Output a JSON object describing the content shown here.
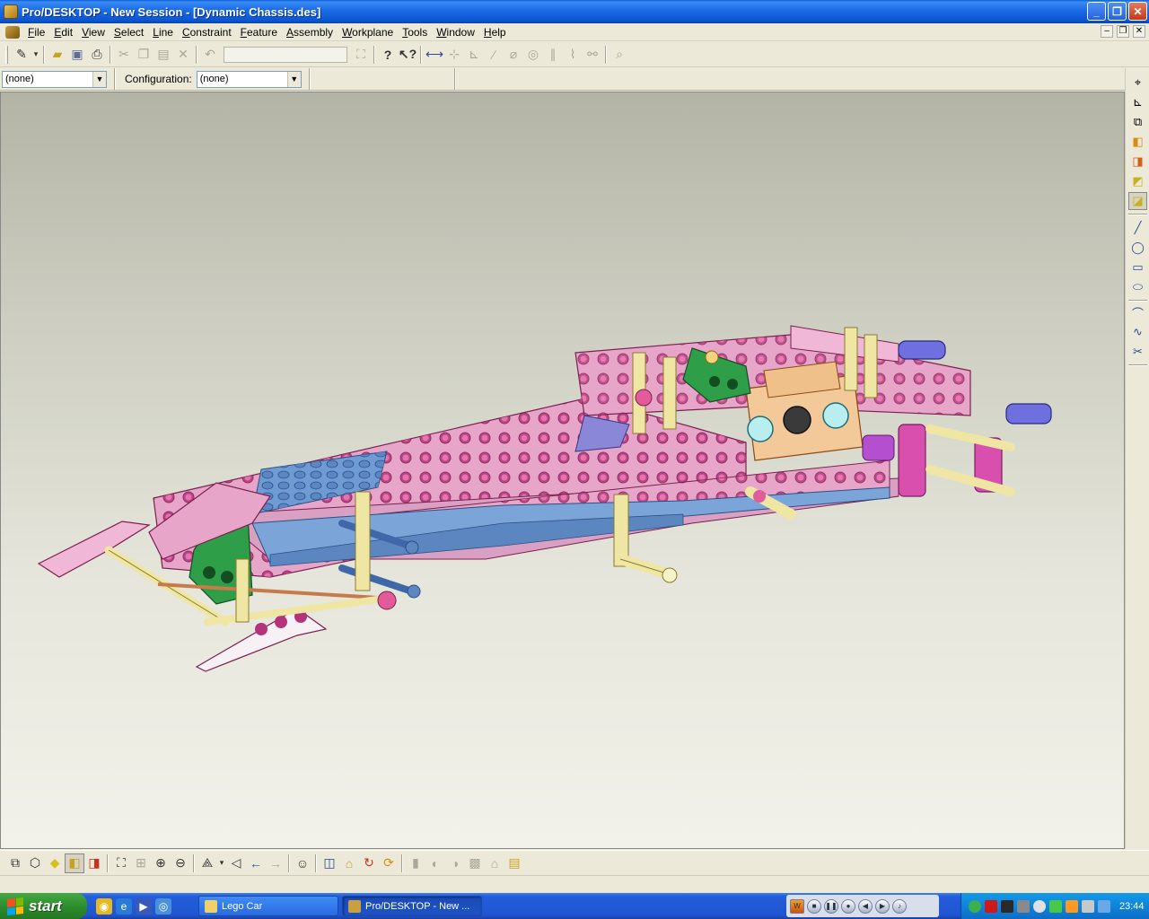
{
  "window": {
    "title": "Pro/DESKTOP - New Session - [Dynamic Chassis.des]",
    "minimize": "_",
    "maximize": "❐",
    "close": "✕"
  },
  "menu": [
    "File",
    "Edit",
    "View",
    "Select",
    "Line",
    "Constraint",
    "Feature",
    "Assembly",
    "Workplane",
    "Tools",
    "Window",
    "Help"
  ],
  "toolbar2": {
    "combo_value": "(none)",
    "configuration_label": "Configuration:",
    "configuration_value": "(none)"
  },
  "taskbar": {
    "start_label": "start",
    "tasks": [
      {
        "label": "Lego Car"
      },
      {
        "label": "Pro/DESKTOP - New ..."
      }
    ],
    "clock": "23:44"
  },
  "colors": {
    "title_bar": "#1d6ee8",
    "chassis_pink": "#e7a6c9",
    "chassis_blue": "#6e9bd4",
    "lever_green": "#2f9e48",
    "pin_yellow": "#efe6a3",
    "axle_purple": "#6f6fe0"
  }
}
